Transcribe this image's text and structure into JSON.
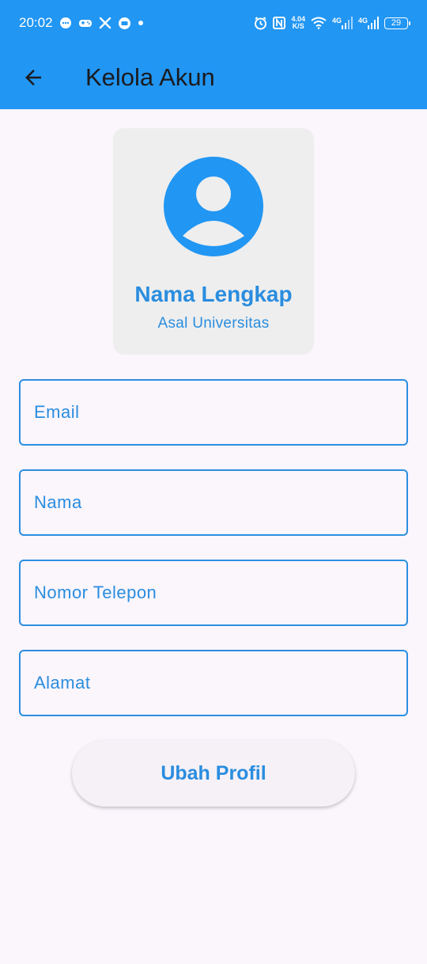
{
  "status_bar": {
    "time": "20:02",
    "net_speed_value": "4.04",
    "net_speed_unit": "K/S",
    "network_1": "4G",
    "network_2": "4G",
    "battery": "29",
    "icons": [
      "chat-bubble-icon",
      "game-controller-icon",
      "x-logo-icon",
      "message-icon",
      "dot-icon",
      "alarm-icon",
      "nfc-icon",
      "wifi-icon",
      "signal-icon",
      "battery-icon"
    ]
  },
  "app_bar": {
    "title": "Kelola Akun",
    "back_icon": "arrow-left-icon",
    "background": "#2196f3"
  },
  "profile": {
    "name": "Nama Lengkap",
    "university": "Asal Universitas",
    "avatar_icon": "account-circle-icon"
  },
  "form": {
    "email_placeholder": "Email",
    "nama_placeholder": "Nama",
    "telepon_placeholder": "Nomor Telepon",
    "alamat_placeholder": "Alamat"
  },
  "actions": {
    "submit_label": "Ubah Profil"
  },
  "colors": {
    "accent": "#2196f3",
    "text_accent": "#2a8ddf",
    "background": "#fbf5fc"
  }
}
